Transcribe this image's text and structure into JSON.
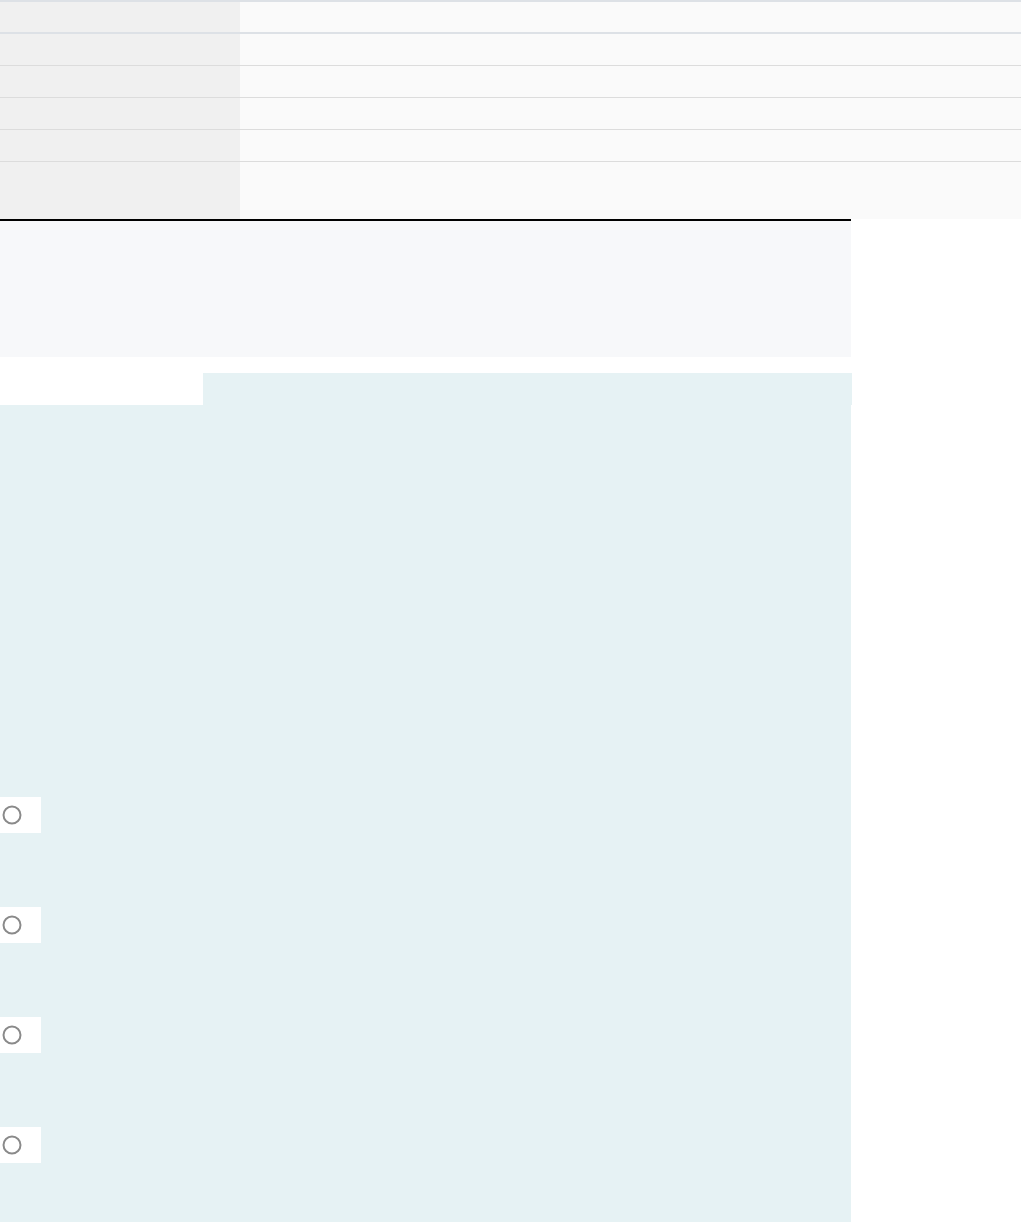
{
  "table": {
    "rows": [
      {
        "kind": "header"
      },
      {
        "kind": "row"
      },
      {
        "kind": "row"
      },
      {
        "kind": "row"
      },
      {
        "kind": "row"
      },
      {
        "kind": "tall"
      }
    ]
  },
  "question": {
    "options": [
      {
        "selected": false
      },
      {
        "selected": false
      },
      {
        "selected": false
      },
      {
        "selected": false
      }
    ]
  }
}
